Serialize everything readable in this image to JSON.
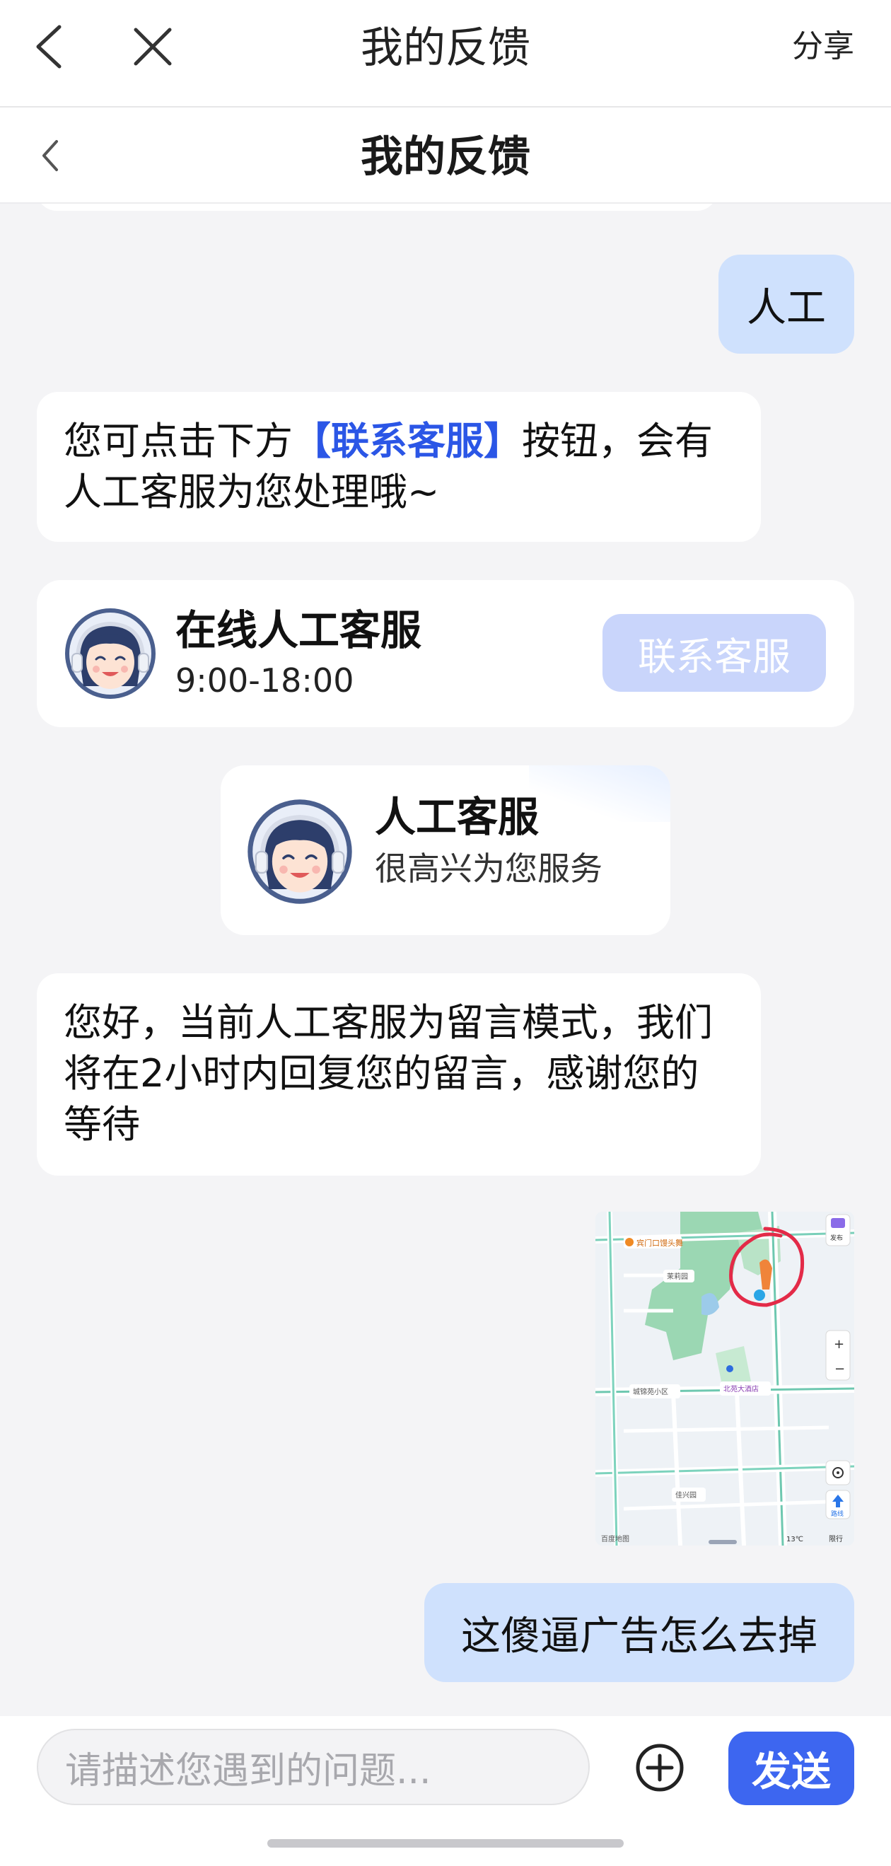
{
  "browser_bar": {
    "title": "我的反馈",
    "share_label": "分享"
  },
  "page_header": {
    "title": "我的反馈"
  },
  "messages": {
    "user_msg_1": "人工",
    "bot_msg_1": {
      "prefix": "您可点击下方",
      "link": "【联系客服】",
      "suffix": "按钮，会有人工客服为您处理哦~"
    },
    "service_card": {
      "name": "在线人工客服",
      "hours": "9:00-18:00",
      "button": "联系客服"
    },
    "agent_card": {
      "name": "人工客服",
      "subtitle": "很高兴为您服务"
    },
    "bot_msg_2": "您好，当前人工客服为留言模式，我们将在2小时内回复您的留言，感谢您的等待",
    "user_map_image": {
      "labels": [
        "宾门口馒头舞",
        "茉莉园",
        "城锦苑小区",
        "北苑大酒店",
        "佳兴园",
        "发布",
        "路线",
        "限行",
        "13℃",
        "百度地图"
      ]
    },
    "user_msg_2": "这傻逼广告怎么去掉"
  },
  "input_bar": {
    "placeholder": "请描述您遇到的问题...",
    "send_label": "发送"
  },
  "colors": {
    "accent": "#3d66f0",
    "user_bubble": "#cfe1fd",
    "link": "#2b56e6",
    "disabled_button": "#c9d5fb"
  }
}
